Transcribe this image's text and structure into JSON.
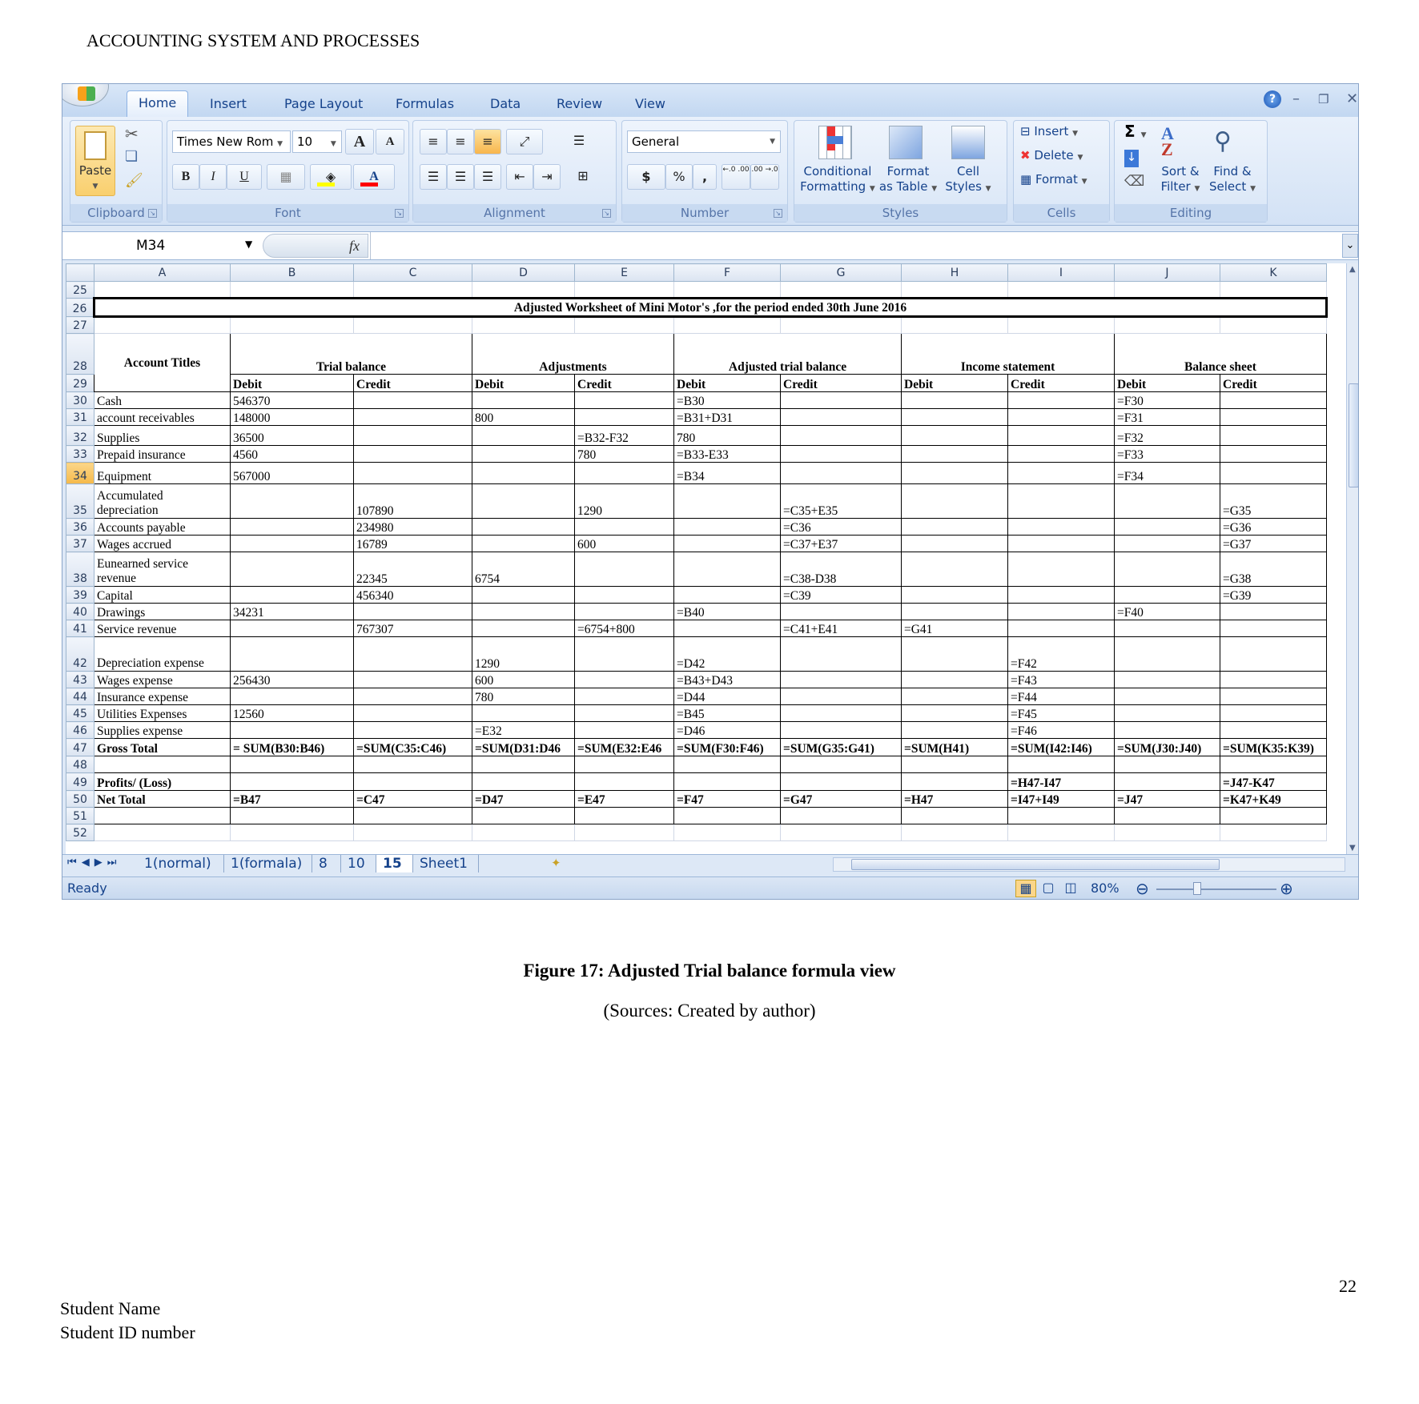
{
  "document": {
    "header": "ACCOUNTING SYSTEM AND PROCESSES",
    "caption": "Figure 17: Adjusted Trial balance formula view",
    "sources": "(Sources: Created by author)",
    "page_number": "22",
    "footer_name": "Student Name",
    "footer_id": "Student ID number"
  },
  "excel": {
    "ribbon_tabs": [
      "Home",
      "Insert",
      "Page Layout",
      "Formulas",
      "Data",
      "Review",
      "View"
    ],
    "active_tab": "Home",
    "clipboard": {
      "paste": "Paste",
      "label": "Clipboard"
    },
    "font": {
      "name": "Times New Rom",
      "size": "10",
      "bold": "B",
      "italic": "I",
      "underline": "U",
      "grow": "A",
      "shrink": "A",
      "color": "A",
      "label": "Font",
      "fill_color": "#ffff00",
      "font_color": "#ff0000"
    },
    "alignment": {
      "label": "Alignment"
    },
    "number": {
      "format": "General",
      "currency": "$",
      "percent": "%",
      "comma": ",",
      "inc_decimal": "←.0 .00",
      "dec_decimal": ".00 →.0",
      "label": "Number"
    },
    "styles": {
      "conditional": [
        "Conditional",
        "Formatting"
      ],
      "format_table": [
        "Format",
        "as Table"
      ],
      "cell_styles": [
        "Cell",
        "Styles"
      ],
      "label": "Styles"
    },
    "cells": {
      "insert": "Insert",
      "delete": "Delete",
      "format": "Format",
      "label": "Cells"
    },
    "editing": {
      "sum": "Σ",
      "sort": [
        "Sort &",
        "Filter"
      ],
      "find": [
        "Find &",
        "Select"
      ],
      "label": "Editing"
    },
    "name_box": "M34",
    "fx": "fx",
    "formula": "",
    "columns": [
      "A",
      "B",
      "C",
      "D",
      "E",
      "F",
      "G",
      "H",
      "I",
      "J",
      "K"
    ],
    "selected_row": "34",
    "title": "Adjusted Worksheet of Mini Motor's ,for the period ended 30th June 2016",
    "header_groups": [
      "Account Titles",
      "Trial balance",
      "Adjustments",
      "Adjusted trial balance",
      "Income statement",
      "Balance sheet"
    ],
    "subheaders": [
      "Debit",
      "Credit",
      "Debit",
      "Credit",
      "Debit",
      "Credit",
      "Debit",
      "Credit",
      "Debit",
      "Credit"
    ],
    "rows": [
      {
        "num": "30",
        "cells": [
          "Cash",
          "546370",
          "",
          "",
          "",
          "=B30",
          "",
          "",
          "",
          "=F30",
          ""
        ]
      },
      {
        "num": "31",
        "cells": [
          "account receivables",
          "148000",
          "",
          "800",
          "",
          "=B31+D31",
          "",
          "",
          "",
          "=F31",
          ""
        ]
      },
      {
        "num": "32",
        "cells": [
          "Supplies",
          "36500",
          "",
          "",
          "=B32-F32",
          "780",
          "",
          "",
          "",
          "=F32",
          ""
        ]
      },
      {
        "num": "33",
        "cells": [
          "Prepaid insurance",
          "4560",
          "",
          "",
          "780",
          "=B33-E33",
          "",
          "",
          "",
          "=F33",
          ""
        ]
      },
      {
        "num": "34",
        "cells": [
          "Equipment",
          "567000",
          "",
          "",
          "",
          "=B34",
          "",
          "",
          "",
          "=F34",
          ""
        ]
      },
      {
        "num": "35",
        "cells": [
          "Accumulated depreciation",
          "",
          "107890",
          "",
          "1290",
          "",
          "=C35+E35",
          "",
          "",
          "",
          "=G35"
        ]
      },
      {
        "num": "36",
        "cells": [
          "Accounts payable",
          "",
          "234980",
          "",
          "",
          "",
          "=C36",
          "",
          "",
          "",
          "=G36"
        ]
      },
      {
        "num": "37",
        "cells": [
          "Wages accrued",
          "",
          "16789",
          "",
          "600",
          "",
          "=C37+E37",
          "",
          "",
          "",
          "=G37"
        ]
      },
      {
        "num": "38",
        "cells": [
          "Eunearned service revenue",
          "",
          "22345",
          "6754",
          "",
          "",
          "=C38-D38",
          "",
          "",
          "",
          "=G38"
        ]
      },
      {
        "num": "39",
        "cells": [
          "Capital",
          "",
          "456340",
          "",
          "",
          "",
          "=C39",
          "",
          "",
          "",
          "=G39"
        ]
      },
      {
        "num": "40",
        "cells": [
          "Drawings",
          "34231",
          "",
          "",
          "",
          "=B40",
          "",
          "",
          "",
          "=F40",
          ""
        ]
      },
      {
        "num": "41",
        "cells": [
          "Service revenue",
          "",
          "767307",
          "",
          "=6754+800",
          "",
          "=C41+E41",
          "=G41",
          "",
          "",
          ""
        ]
      },
      {
        "num": "42",
        "cells": [
          "Depreciation expense",
          "",
          "",
          "1290",
          "",
          "=D42",
          "",
          "",
          "=F42",
          "",
          ""
        ]
      },
      {
        "num": "43",
        "cells": [
          "Wages expense",
          "256430",
          "",
          "600",
          "",
          "=B43+D43",
          "",
          "",
          "=F43",
          "",
          ""
        ]
      },
      {
        "num": "44",
        "cells": [
          "Insurance expense",
          "",
          "",
          "780",
          "",
          "=D44",
          "",
          "",
          "=F44",
          "",
          ""
        ]
      },
      {
        "num": "45",
        "cells": [
          "Utilities Expenses",
          "12560",
          "",
          "",
          "",
          "=B45",
          "",
          "",
          "=F45",
          "",
          ""
        ]
      },
      {
        "num": "46",
        "cells": [
          "Supplies expense",
          "",
          "",
          "=E32",
          "",
          "=D46",
          "",
          "",
          "=F46",
          "",
          ""
        ]
      },
      {
        "num": "47",
        "cells": [
          "Gross Total",
          "= SUM(B30:B46)",
          "=SUM(C35:C46)",
          "=SUM(D31:D46",
          "=SUM(E32:E46",
          "=SUM(F30:F46)",
          "=SUM(G35:G41)",
          "=SUM(H41)",
          "=SUM(I42:I46)",
          "=SUM(J30:J40)",
          "=SUM(K35:K39)"
        ]
      },
      {
        "num": "48",
        "cells": [
          "",
          "",
          "",
          "",
          "",
          "",
          "",
          "",
          "",
          "",
          ""
        ]
      },
      {
        "num": "49",
        "cells": [
          "Profits/ (Loss)",
          "",
          "",
          "",
          "",
          "",
          "",
          "",
          "=H47-I47",
          "",
          "=J47-K47"
        ]
      },
      {
        "num": "50",
        "cells": [
          "Net Total",
          "=B47",
          "=C47",
          "=D47",
          "=E47",
          "=F47",
          "=G47",
          "=H47",
          "=I47+I49",
          "=J47",
          "=K47+K49"
        ]
      },
      {
        "num": "51",
        "cells": [
          "",
          "",
          "",
          "",
          "",
          "",
          "",
          "",
          "",
          "",
          ""
        ]
      }
    ],
    "sheet_tabs": [
      "1(normal)",
      "1(formala)",
      "8",
      "10",
      "15",
      "Sheet1"
    ],
    "active_sheet": "15",
    "status": "Ready",
    "zoom": "80%"
  }
}
